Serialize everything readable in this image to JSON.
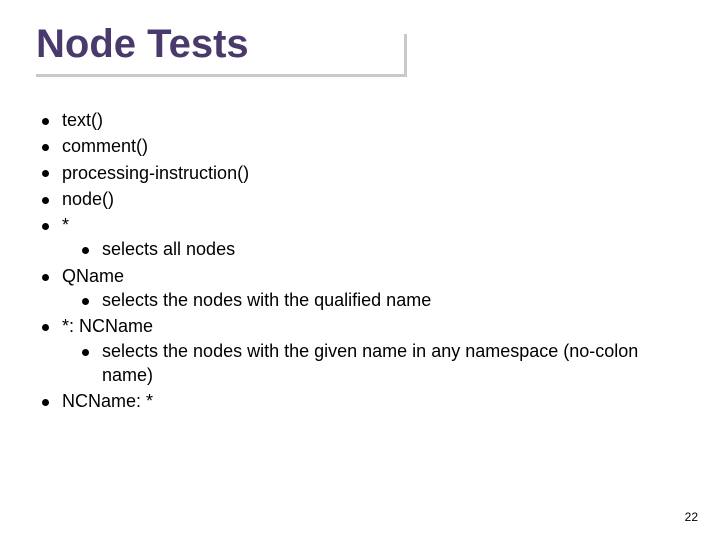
{
  "title": "Node Tests",
  "items": [
    {
      "text": "text()"
    },
    {
      "text": "comment()"
    },
    {
      "text": "processing-instruction()"
    },
    {
      "text": "node()"
    },
    {
      "text": "*",
      "sub": [
        "selects all nodes"
      ]
    },
    {
      "text": "QName",
      "sub": [
        "selects the nodes with the qualified name"
      ]
    },
    {
      "text": "*: NCName",
      "sub": [
        "selects the nodes with the given name in any namespace (no-colon name)"
      ]
    },
    {
      "text": "NCName: *"
    }
  ],
  "page_number": "22"
}
